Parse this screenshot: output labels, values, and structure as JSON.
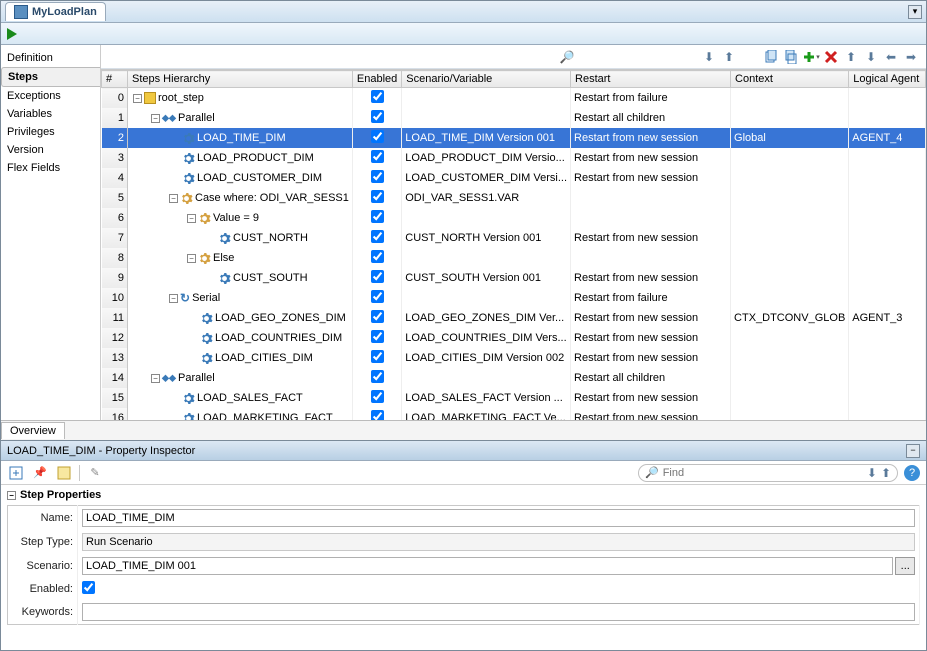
{
  "window": {
    "title": "MyLoadPlan"
  },
  "side_tabs": [
    "Definition",
    "Steps",
    "Exceptions",
    "Variables",
    "Privileges",
    "Version",
    "Flex Fields"
  ],
  "side_tab_active": "Steps",
  "columns": [
    "#",
    "Steps Hierarchy",
    "Enabled",
    "Scenario/Variable",
    "Restart",
    "Context",
    "Logical Agent"
  ],
  "rows": [
    {
      "num": 0,
      "indent": 0,
      "toggle": "-",
      "icon": "flag",
      "label": "root_step",
      "enabled": true,
      "scenario": "",
      "restart": "Restart from failure",
      "context": "",
      "agent": ""
    },
    {
      "num": 1,
      "indent": 1,
      "toggle": "-",
      "icon": "parallel",
      "label": "Parallel",
      "enabled": true,
      "scenario": "",
      "restart": "Restart all children",
      "context": "",
      "agent": ""
    },
    {
      "num": 2,
      "indent": 2,
      "toggle": "",
      "icon": "gear",
      "label": "LOAD_TIME_DIM",
      "enabled": true,
      "scenario": "LOAD_TIME_DIM Version 001",
      "restart": "Restart from new session",
      "context": "Global",
      "agent": "AGENT_4",
      "selected": true
    },
    {
      "num": 3,
      "indent": 2,
      "toggle": "",
      "icon": "gear",
      "label": "LOAD_PRODUCT_DIM",
      "enabled": true,
      "scenario": "LOAD_PRODUCT_DIM Versio...",
      "restart": "Restart from new session",
      "context": "",
      "agent": ""
    },
    {
      "num": 4,
      "indent": 2,
      "toggle": "",
      "icon": "gear",
      "label": "LOAD_CUSTOMER_DIM",
      "enabled": true,
      "scenario": "LOAD_CUSTOMER_DIM Versi...",
      "restart": "Restart from new session",
      "context": "",
      "agent": ""
    },
    {
      "num": 5,
      "indent": 2,
      "toggle": "-",
      "icon": "case",
      "label": "Case where: ODI_VAR_SESS1",
      "enabled": true,
      "scenario": "ODI_VAR_SESS1.VAR",
      "restart": "",
      "context": "",
      "agent": ""
    },
    {
      "num": 6,
      "indent": 3,
      "toggle": "-",
      "icon": "when",
      "label": "Value = 9",
      "enabled": true,
      "scenario": "",
      "restart": "",
      "context": "",
      "agent": ""
    },
    {
      "num": 7,
      "indent": 4,
      "toggle": "",
      "icon": "gear",
      "label": "CUST_NORTH",
      "enabled": true,
      "scenario": "CUST_NORTH Version 001",
      "restart": "Restart from new session",
      "context": "",
      "agent": ""
    },
    {
      "num": 8,
      "indent": 3,
      "toggle": "-",
      "icon": "when",
      "label": "Else",
      "enabled": true,
      "scenario": "",
      "restart": "",
      "context": "",
      "agent": ""
    },
    {
      "num": 9,
      "indent": 4,
      "toggle": "",
      "icon": "gear",
      "label": "CUST_SOUTH",
      "enabled": true,
      "scenario": "CUST_SOUTH Version 001",
      "restart": "Restart from new session",
      "context": "",
      "agent": ""
    },
    {
      "num": 10,
      "indent": 2,
      "toggle": "-",
      "icon": "serial",
      "label": "Serial",
      "enabled": true,
      "scenario": "",
      "restart": "Restart from failure",
      "context": "",
      "agent": ""
    },
    {
      "num": 11,
      "indent": 3,
      "toggle": "",
      "icon": "gear",
      "label": "LOAD_GEO_ZONES_DIM",
      "enabled": true,
      "scenario": "LOAD_GEO_ZONES_DIM Ver...",
      "restart": "Restart from new session",
      "context": "CTX_DTCONV_GLOB",
      "agent": "AGENT_3"
    },
    {
      "num": 12,
      "indent": 3,
      "toggle": "",
      "icon": "gear",
      "label": "LOAD_COUNTRIES_DIM",
      "enabled": true,
      "scenario": "LOAD_COUNTRIES_DIM Vers...",
      "restart": "Restart from new session",
      "context": "",
      "agent": ""
    },
    {
      "num": 13,
      "indent": 3,
      "toggle": "",
      "icon": "gear",
      "label": "LOAD_CITIES_DIM",
      "enabled": true,
      "scenario": "LOAD_CITIES_DIM Version 002",
      "restart": "Restart from new session",
      "context": "",
      "agent": ""
    },
    {
      "num": 14,
      "indent": 1,
      "toggle": "-",
      "icon": "parallel",
      "label": "Parallel",
      "enabled": true,
      "scenario": "",
      "restart": "Restart all children",
      "context": "",
      "agent": ""
    },
    {
      "num": 15,
      "indent": 2,
      "toggle": "",
      "icon": "gear",
      "label": "LOAD_SALES_FACT",
      "enabled": true,
      "scenario": "LOAD_SALES_FACT Version ...",
      "restart": "Restart from new session",
      "context": "",
      "agent": ""
    },
    {
      "num": 16,
      "indent": 2,
      "toggle": "",
      "icon": "gear",
      "label": "LOAD_MARKETING_FACT",
      "enabled": true,
      "scenario": "LOAD_MARKETING_FACT Ve...",
      "restart": "Restart from new session",
      "context": "",
      "agent": ""
    }
  ],
  "overview_tab": "Overview",
  "inspector": {
    "title": "LOAD_TIME_DIM - Property Inspector",
    "find_placeholder": "Find",
    "group": "Step Properties",
    "props": {
      "name_label": "Name:",
      "name_value": "LOAD_TIME_DIM",
      "steptype_label": "Step Type:",
      "steptype_value": "Run Scenario",
      "scenario_label": "Scenario:",
      "scenario_value": "LOAD_TIME_DIM 001",
      "enabled_label": "Enabled:",
      "enabled_value": true,
      "keywords_label": "Keywords:",
      "keywords_value": ""
    }
  }
}
